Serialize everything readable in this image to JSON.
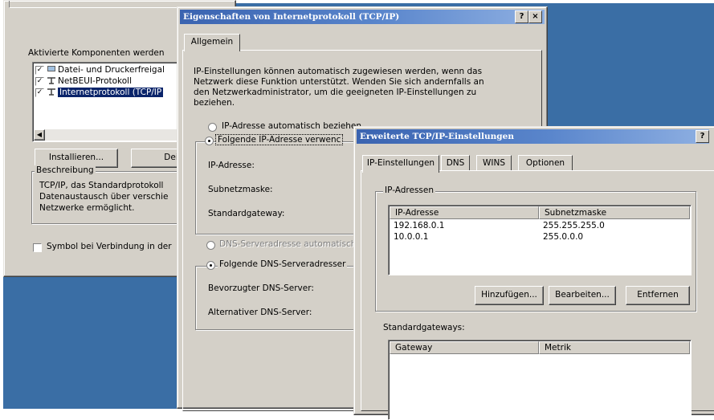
{
  "conn_props": {
    "components_label": "Aktivierte Komponenten werden",
    "components": [
      {
        "label": "Datei- und Druckerfreigal",
        "checked": true,
        "selected": false
      },
      {
        "label": "NetBEUI-Protokoll",
        "checked": true,
        "selected": false
      },
      {
        "label": "Internetprotokoll (TCP/IP",
        "checked": true,
        "selected": true
      }
    ],
    "install_button": "Installieren...",
    "uninstall_button": "Deinst",
    "description_legend": "Beschreibung",
    "description_text": [
      "TCP/IP, das Standardprotokoll",
      "Datenaustausch über verschie",
      "Netzwerke ermöglicht."
    ],
    "show_icon_label": "Symbol bei Verbindung in der"
  },
  "tcpip_props": {
    "title": "Eigenschaften von Internetprotokoll (TCP/IP)",
    "help_glyph": "?",
    "close_glyph": "×",
    "tab_general": "Allgemein",
    "intro_text": [
      "IP-Einstellungen können automatisch zugewiesen werden, wenn das",
      "Netzwerk diese Funktion unterstützt. Wenden Sie sich andernfalls an",
      "den Netzwerkadministrator, um die geeigneten IP-Einstellungen zu",
      "beziehen."
    ],
    "radio_auto_ip": "IP-Adresse automatisch beziehen",
    "radio_manual_ip": "Folgende IP-Adresse verwenc",
    "ip_address_label": "IP-Adresse:",
    "subnet_label": "Subnetzmaske:",
    "gateway_label": "Standardgateway:",
    "radio_auto_dns": "DNS-Serveradresse automatisch",
    "radio_manual_dns": "Folgende DNS-Serveradresser",
    "preferred_dns_label": "Bevorzugter DNS-Server:",
    "alternate_dns_label": "Alternativer DNS-Server:"
  },
  "advanced": {
    "title": "Erweiterte TCP/IP-Einstellungen",
    "help_glyph": "?",
    "close_glyph": "×",
    "tabs": [
      "IP-Einstellungen",
      "DNS",
      "WINS",
      "Optionen"
    ],
    "ip_group_label": "IP-Adressen",
    "ip_columns": [
      "IP-Adresse",
      "Subnetzmaske"
    ],
    "ip_rows": [
      [
        "192.168.0.1",
        "255.255.255.0"
      ],
      [
        "10.0.0.1",
        "255.0.0.0"
      ]
    ],
    "add_button": "Hinzufügen...",
    "edit_button": "Bearbeiten...",
    "remove_button": "Entfernen",
    "gateways_label": "Standardgateways:",
    "gateway_columns": [
      "Gateway",
      "Metrik"
    ]
  },
  "colors": {
    "desktop": "#3a6ea5",
    "dialog_face": "#d4d0c8",
    "title_active": "#3a63b0",
    "selection": "#0a246a"
  }
}
